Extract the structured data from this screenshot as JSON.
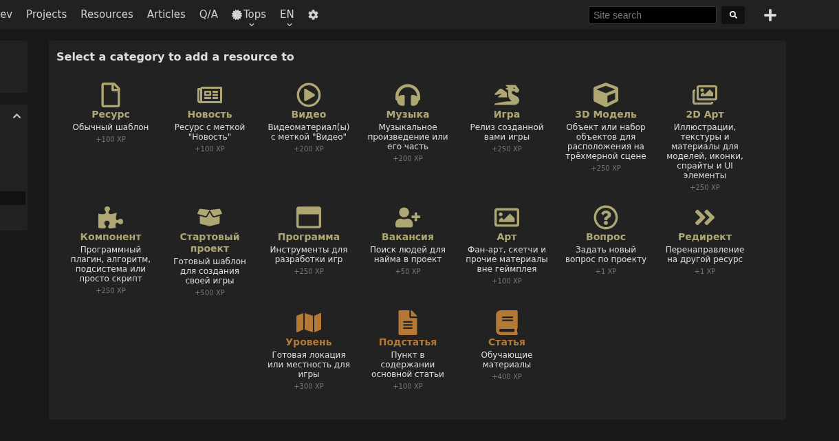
{
  "nav": {
    "items": [
      {
        "label": "ev",
        "kind": "link"
      },
      {
        "label": "Projects",
        "kind": "link"
      },
      {
        "label": "Resources",
        "kind": "link"
      },
      {
        "label": "Articles",
        "kind": "link"
      },
      {
        "label": "Q/A",
        "kind": "link"
      },
      {
        "label": "Tops",
        "kind": "dropdown-star"
      },
      {
        "label": "EN",
        "kind": "dropdown"
      }
    ],
    "search": {
      "placeholder": "Site search"
    }
  },
  "panel": {
    "title": "Select a category to add a resource to",
    "categories": [
      {
        "name": "Ресурс",
        "description": "Обычный шаблон",
        "xp": "+100 XP",
        "color": "#aea773"
      },
      {
        "name": "Новость",
        "description": "Ресурс с меткой \"Новость\"",
        "xp": "+100 XP",
        "color": "#aea773"
      },
      {
        "name": "Видео",
        "description": "Видеоматериал(ы) с меткой \"Видео\"",
        "xp": "+200 XP",
        "color": "#aea773"
      },
      {
        "name": "Музыка",
        "description": "Музыкальное произведение или его часть",
        "xp": "+200 XP",
        "color": "#aea773"
      },
      {
        "name": "Игра",
        "description": "Релиз созданной вами игры",
        "xp": "+250 XP",
        "color": "#aea773"
      },
      {
        "name": "3D Модель",
        "description": "Объект или набор объектов для расположения на трёхмерной сцене",
        "xp": "+250 XP",
        "color": "#aea773"
      },
      {
        "name": "2D Арт",
        "description": "Иллюстрации, текстуры и материалы для моделей, иконки, спрайты и UI элементы",
        "xp": "+250 XP",
        "color": "#aea773"
      },
      {
        "name": "Компонент",
        "description": "Программный плагин, алгоритм, подсистема или просто скрипт",
        "xp": "+250 XP",
        "color": "#aea773"
      },
      {
        "name": "Стартовый проект",
        "description": "Готовый шаблон для создания своей игры",
        "xp": "+500 XP",
        "color": "#aea773"
      },
      {
        "name": "Программа",
        "description": "Инструменты для разработки игр",
        "xp": "+250 XP",
        "color": "#aea773"
      },
      {
        "name": "Вакансия",
        "description": "Поиск людей для найма в проект",
        "xp": "+50 XP",
        "color": "#aea773"
      },
      {
        "name": "Арт",
        "description": "Фан-арт, скетчи и прочие материалы вне геймплея",
        "xp": "+100 XP",
        "color": "#aea773"
      },
      {
        "name": "Вопрос",
        "description": "Задать новый вопрос по проекту",
        "xp": "+1 XP",
        "color": "#aea773"
      },
      {
        "name": "Редирект",
        "description": "Перенаправление на другой ресурс",
        "xp": "+1 XP",
        "color": "#aea773"
      },
      {
        "name": "Уровень",
        "description": "Готовая локация или местность для игры",
        "xp": "+300 XP",
        "color": "#b57935"
      },
      {
        "name": "Подстатья",
        "description": "Пункт в содержании основной статьи",
        "xp": "+100 XP",
        "color": "#b57935"
      },
      {
        "name": "Статья",
        "description": "Обучающие материалы",
        "xp": "+400 XP",
        "color": "#b57935"
      }
    ]
  }
}
